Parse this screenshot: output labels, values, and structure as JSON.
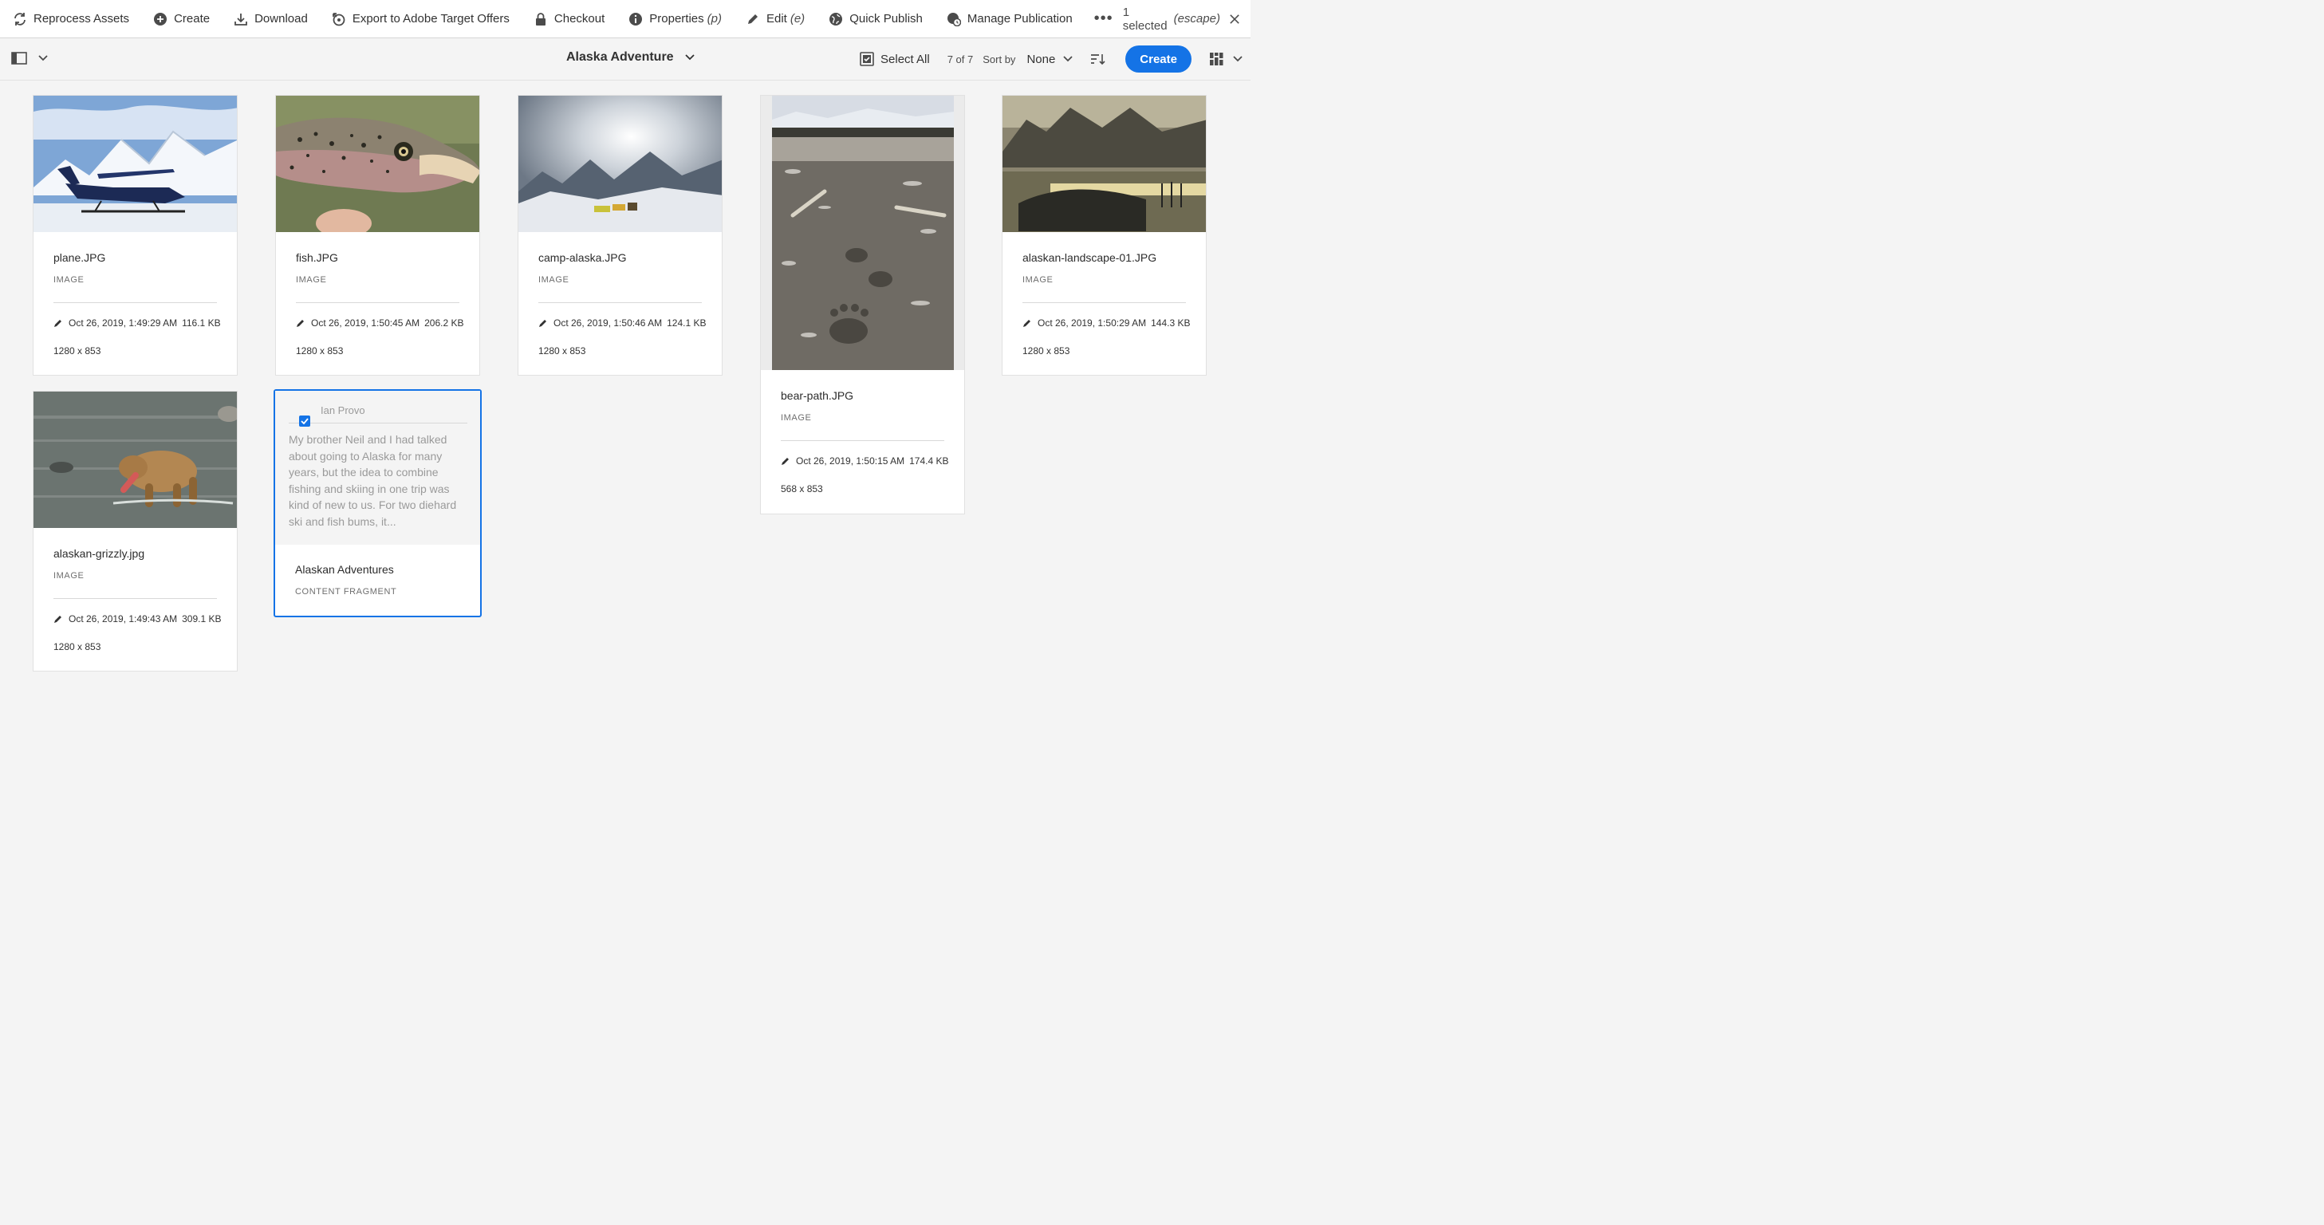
{
  "actionbar": {
    "reprocess": "Reprocess Assets",
    "create": "Create",
    "download": "Download",
    "export": "Export to Adobe Target Offers",
    "checkout": "Checkout",
    "properties": "Properties",
    "properties_hint": "(p)",
    "edit": "Edit",
    "edit_hint": "(e)",
    "quick_publish": "Quick Publish",
    "manage_publication": "Manage Publication",
    "more": "•••",
    "selection_count": "1 selected",
    "selection_hint": "(escape)"
  },
  "titlebar": {
    "folder": "Alaska Adventure",
    "select_all": "Select All",
    "count": "7 of 7",
    "sort_by_label": "Sort by",
    "sort_value": "None",
    "create": "Create"
  },
  "assets": [
    {
      "name": "plane.JPG",
      "type": "IMAGE",
      "modified": "Oct 26, 2019, 1:49:29 AM",
      "size": "116.1 KB",
      "dims": "1280 x 853"
    },
    {
      "name": "fish.JPG",
      "type": "IMAGE",
      "modified": "Oct 26, 2019, 1:50:45 AM",
      "size": "206.2 KB",
      "dims": "1280 x 853"
    },
    {
      "name": "camp-alaska.JPG",
      "type": "IMAGE",
      "modified": "Oct 26, 2019, 1:50:46 AM",
      "size": "124.1 KB",
      "dims": "1280 x 853"
    },
    {
      "name": "bear-path.JPG",
      "type": "IMAGE",
      "modified": "Oct 26, 2019, 1:50:15 AM",
      "size": "174.4 KB",
      "dims": "568 x 853"
    },
    {
      "name": "alaskan-landscape-01.JPG",
      "type": "IMAGE",
      "modified": "Oct 26, 2019, 1:50:29 AM",
      "size": "144.3 KB",
      "dims": "1280 x 853"
    },
    {
      "name": "alaskan-grizzly.jpg",
      "type": "IMAGE",
      "modified": "Oct 26, 2019, 1:49:43 AM",
      "size": "309.1 KB",
      "dims": "1280 x 853"
    }
  ],
  "fragment": {
    "name": "Alaskan Adventures",
    "type": "CONTENT FRAGMENT",
    "preview_heading": "Ian Provo",
    "preview_text": "My brother Neil and I had talked about going to Alaska for many years, but the idea to combine fishing and skiing in one trip was kind of new to us. For two diehard ski and fish bums, it...",
    "selected": true
  },
  "colors": {
    "accent": "#1473e6",
    "background": "#f4f4f4",
    "card": "#ffffff"
  }
}
